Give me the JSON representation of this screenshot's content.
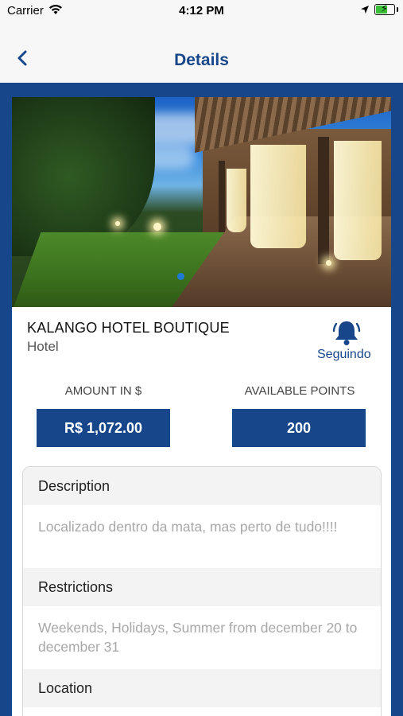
{
  "status_bar": {
    "carrier": "Carrier",
    "time": "4:12 PM"
  },
  "nav": {
    "title": "Details",
    "back_icon": "chevron-left-icon"
  },
  "hotel": {
    "name": "KALANGO HOTEL BOUTIQUE",
    "type": "Hotel",
    "follow_icon": "bell-icon",
    "follow_label": "Seguindo"
  },
  "stats": {
    "amount_label": "AMOUNT IN $",
    "amount_value": "R$ 1,072.00",
    "points_label": "AVAILABLE POINTS",
    "points_value": "200"
  },
  "sections": [
    {
      "title": "Description",
      "body": "Localizado dentro da mata, mas perto de tudo!!!!"
    },
    {
      "title": "Restrictions",
      "body": "Weekends, Holidays, Summer from december 20 to december 31"
    },
    {
      "title": "Location",
      "body": ""
    }
  ],
  "colors": {
    "brand": "#17478a",
    "background": "#f7f7f7",
    "muted_text": "#a8a8a8"
  }
}
